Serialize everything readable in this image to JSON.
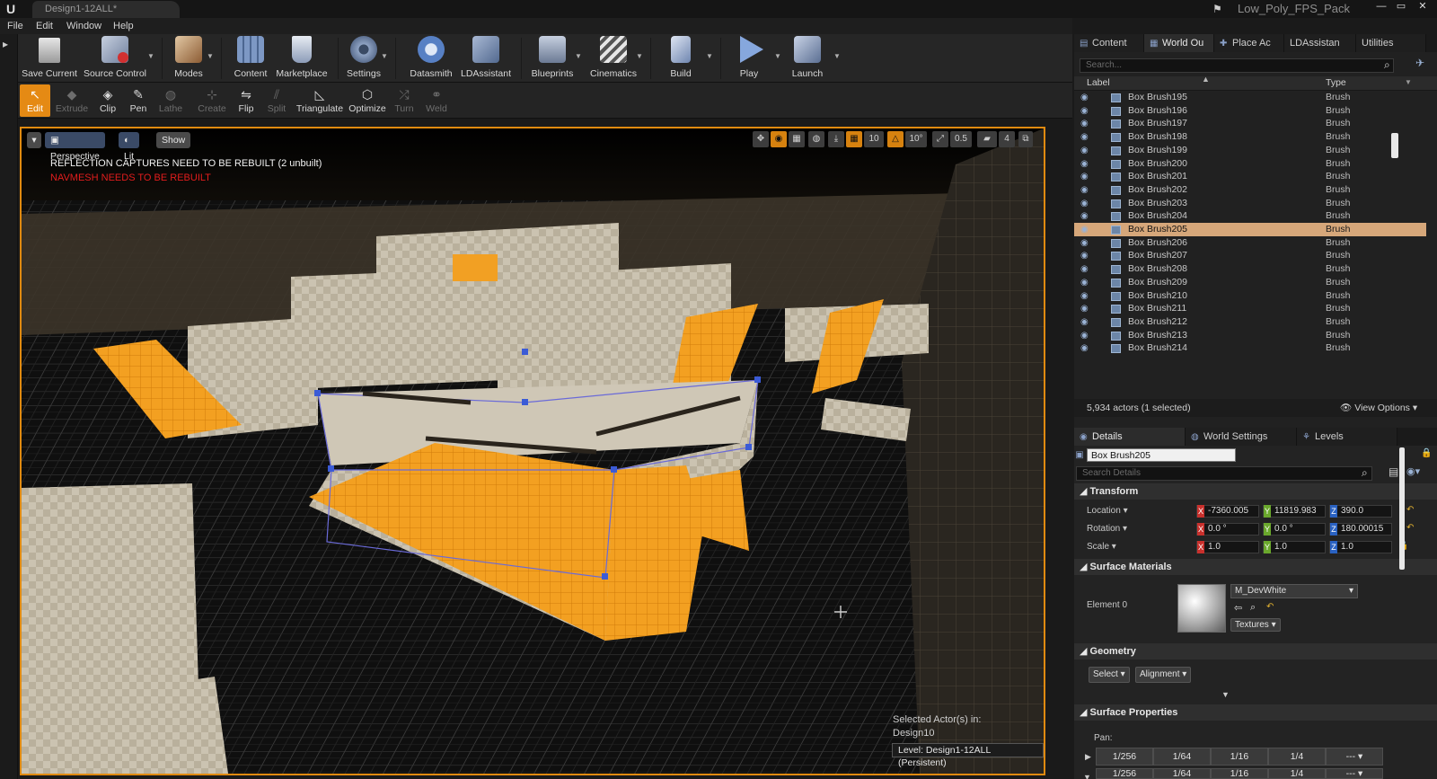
{
  "title_bar": {
    "doc_tab": "Design1-12ALL*",
    "project_name": "Low_Poly_FPS_Pack",
    "controls": [
      "—",
      "▭",
      "✕"
    ]
  },
  "menu": [
    "File",
    "Edit",
    "Window",
    "Help"
  ],
  "toolbar": {
    "buttons": [
      {
        "label": "Save Current",
        "color": "#c9c9c9"
      },
      {
        "label": "Source Control",
        "color": "#9aa7c0"
      },
      {
        "label": "Modes",
        "color": "#b58a5a"
      },
      {
        "label": "Content",
        "color": "#6d88b3"
      },
      {
        "label": "Marketplace",
        "color": "#8aa0c4"
      },
      {
        "label": "Settings",
        "color": "#7a8fb0"
      },
      {
        "label": "Datasmith",
        "color": "#5b84c9"
      },
      {
        "label": "LDAssistant",
        "color": "#7f95bb"
      },
      {
        "label": "Blueprints",
        "color": "#8b97ad"
      },
      {
        "label": "Cinematics",
        "color": "#9aa3b3"
      },
      {
        "label": "Build",
        "color": "#8fa2c8"
      },
      {
        "label": "Play",
        "color": "#7fa1dc"
      },
      {
        "label": "Launch",
        "color": "#8c9bb8"
      }
    ]
  },
  "modes": {
    "buttons": [
      {
        "label": "Edit",
        "icon": "↖",
        "state": "active"
      },
      {
        "label": "Extrude",
        "icon": "◆",
        "state": "disabled"
      },
      {
        "label": "Clip",
        "icon": "◈",
        "state": "normal"
      },
      {
        "label": "Pen",
        "icon": "✎",
        "state": "normal"
      },
      {
        "label": "Lathe",
        "icon": "◍",
        "state": "disabled"
      },
      {
        "label": "Create",
        "icon": "⊹",
        "state": "disabled"
      },
      {
        "label": "Flip",
        "icon": "⇋",
        "state": "normal"
      },
      {
        "label": "Split",
        "icon": "⫽",
        "state": "disabled"
      },
      {
        "label": "Triangulate",
        "icon": "◺",
        "state": "normal"
      },
      {
        "label": "Optimize",
        "icon": "⬡",
        "state": "normal"
      },
      {
        "label": "Turn",
        "icon": "⤮",
        "state": "disabled"
      },
      {
        "label": "Weld",
        "icon": "⚭",
        "state": "disabled"
      }
    ]
  },
  "viewport": {
    "perspective": "Perspective",
    "lit": "Lit",
    "show": "Show",
    "grid_snap": "10",
    "rot_snap": "10°",
    "scale_snap": "0.5",
    "camera_speed": "4",
    "message_reflection": "REFLECTION CAPTURES NEED TO BE REBUILT (2 unbuilt)",
    "message_navmesh": "NAVMESH NEEDS TO BE REBUILT",
    "selected_actors_label": "Selected Actor(s) in:",
    "selected_actors_level": "Design10",
    "level_label": "Level:  Design1-12ALL (Persistent)",
    "colors": {
      "border": "#e08a10",
      "floor": "#0e0e0e",
      "wall": "#c9c1b0",
      "highlight": "#f29a16"
    }
  },
  "outliner": {
    "tabs": [
      "Content",
      "World Ou",
      "Place Ac",
      "LDAssistan",
      "Utilities"
    ],
    "search_placeholder": "Search...",
    "col_label": "Label",
    "col_type": "Type",
    "rows": [
      {
        "label": "Box Brush195",
        "type": "Brush",
        "selected": false
      },
      {
        "label": "Box Brush196",
        "type": "Brush",
        "selected": false
      },
      {
        "label": "Box Brush197",
        "type": "Brush",
        "selected": false
      },
      {
        "label": "Box Brush198",
        "type": "Brush",
        "selected": false
      },
      {
        "label": "Box Brush199",
        "type": "Brush",
        "selected": false
      },
      {
        "label": "Box Brush200",
        "type": "Brush",
        "selected": false
      },
      {
        "label": "Box Brush201",
        "type": "Brush",
        "selected": false
      },
      {
        "label": "Box Brush202",
        "type": "Brush",
        "selected": false
      },
      {
        "label": "Box Brush203",
        "type": "Brush",
        "selected": false
      },
      {
        "label": "Box Brush204",
        "type": "Brush",
        "selected": false
      },
      {
        "label": "Box Brush205",
        "type": "Brush",
        "selected": true
      },
      {
        "label": "Box Brush206",
        "type": "Brush",
        "selected": false
      },
      {
        "label": "Box Brush207",
        "type": "Brush",
        "selected": false
      },
      {
        "label": "Box Brush208",
        "type": "Brush",
        "selected": false
      },
      {
        "label": "Box Brush209",
        "type": "Brush",
        "selected": false
      },
      {
        "label": "Box Brush210",
        "type": "Brush",
        "selected": false
      },
      {
        "label": "Box Brush211",
        "type": "Brush",
        "selected": false
      },
      {
        "label": "Box Brush212",
        "type": "Brush",
        "selected": false
      },
      {
        "label": "Box Brush213",
        "type": "Brush",
        "selected": false
      },
      {
        "label": "Box Brush214",
        "type": "Brush",
        "selected": false
      }
    ],
    "footer_count": "5,934 actors (1 selected)",
    "view_options": "View Options"
  },
  "details": {
    "tabs": [
      "Details",
      "World Settings",
      "Levels"
    ],
    "actor_name": "Box Brush205",
    "search_placeholder": "Search Details",
    "transform": {
      "title": "Transform",
      "location_label": "Location",
      "rotation_label": "Rotation",
      "scale_label": "Scale",
      "location": [
        "-7360.005",
        "11819.983",
        "390.0"
      ],
      "rotation": [
        "0.0 °",
        "0.0 °",
        "180.00015"
      ],
      "scale": [
        "1.0",
        "1.0",
        "1.0"
      ]
    },
    "surface_materials": {
      "title": "Surface Materials",
      "element_label": "Element 0",
      "material": "M_DevWhite",
      "textures": "Textures"
    },
    "geometry": {
      "title": "Geometry",
      "select": "Select",
      "alignment": "Alignment"
    },
    "surface_properties": {
      "title": "Surface Properties",
      "pan_label": "Pan:",
      "pan_values": [
        "1/256",
        "1/64",
        "1/16",
        "1/4",
        "---"
      ]
    }
  }
}
